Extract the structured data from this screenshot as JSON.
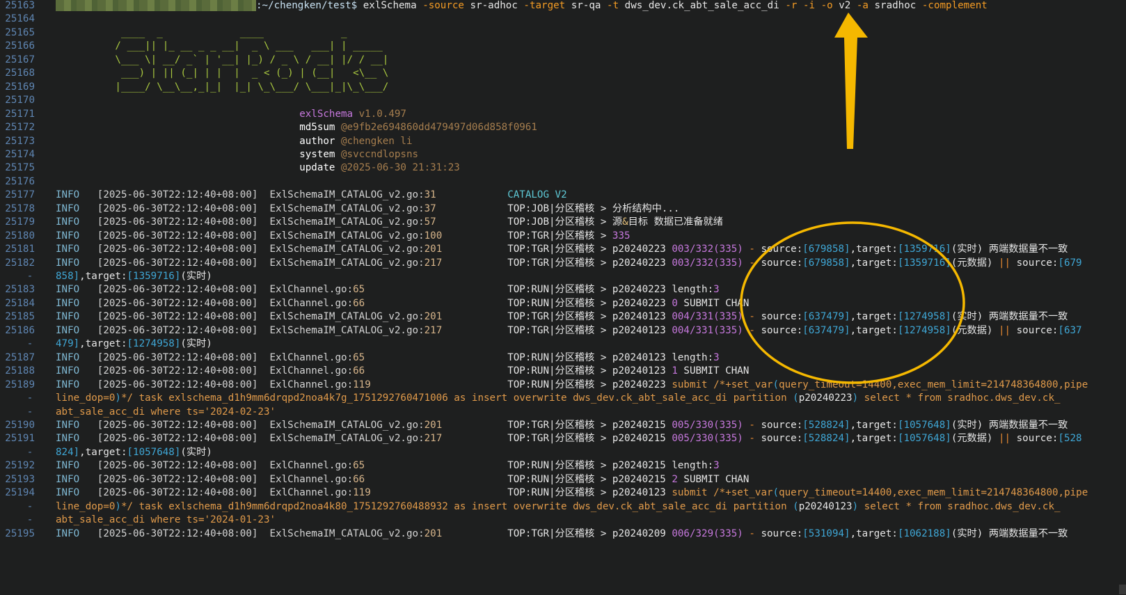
{
  "terminal": {
    "prompt": {
      "path": ":~/chengken/test$",
      "command": "exlSchema",
      "args": [
        {
          "flag": "-source",
          "value": "sr-adhoc"
        },
        {
          "flag": "-target",
          "value": "sr-qa"
        },
        {
          "flag": "-t",
          "value": "dws_dev.ck_abt_sale_acc_di"
        },
        {
          "flag": "-r",
          "value": ""
        },
        {
          "flag": "-i",
          "value": ""
        },
        {
          "flag": "-o",
          "value": "v2"
        },
        {
          "flag": "-a",
          "value": "sradhoc"
        },
        {
          "flag": "-complement",
          "value": ""
        }
      ]
    },
    "ascii_art": [
      " ____  _             ____             _",
      "/ ___|| |_ __ _ _ __|  _ \\ ___   ___| | _____",
      "\\___ \\| __/ _` | '__| |_) / _ \\ / __| |/ / __|",
      " ___) | || (_| | |  |  _ < (_) | (__|   <\\__ \\",
      "|____/ \\__\\__,_|_|  |_| \\_\\___/ \\___|_|\\_\\___/"
    ],
    "meta": {
      "name": "exlSchema",
      "version": "v1.0.497",
      "md5sum_label": "md5sum",
      "md5sum": "@e9fb2e694860dd479497d06d858f0961",
      "author_label": "author",
      "author": "@chengken li",
      "system_label": "system",
      "system": "@svccndlopsns",
      "update_label": "update",
      "update": "@2025-06-30 21:31:23"
    },
    "line_numbers": [
      "25163",
      "25164",
      "25165",
      "25166",
      "25167",
      "25168",
      "25169",
      "25170",
      "25171",
      "25172",
      "25173",
      "25174",
      "25175",
      "25176",
      "25177",
      "25178",
      "25179",
      "25180",
      "25181",
      "25182",
      "25183",
      "25184",
      "25185",
      "25186",
      "25187",
      "25188",
      "25189",
      "25190",
      "25191",
      "25192",
      "25193",
      "25194",
      "25195"
    ],
    "logs": [
      {
        "level": "INFO",
        "ts": "2025-06-30T22:12:40+08:00",
        "file": "ExlSchemaIM_CATALOG_v2.go",
        "line": "31",
        "msg": [
          {
            "t": "CATALOG V2",
            "c": "cat"
          }
        ]
      },
      {
        "level": "INFO",
        "ts": "2025-06-30T22:12:40+08:00",
        "file": "ExlSchemaIM_CATALOG_v2.go",
        "line": "37",
        "msg": [
          {
            "t": "TOP:JOB|分区稽核 > 分析结构中...",
            "c": "msg"
          }
        ]
      },
      {
        "level": "INFO",
        "ts": "2025-06-30T22:12:40+08:00",
        "file": "ExlSchemaIM_CATALOG_v2.go",
        "line": "57",
        "msg": [
          {
            "t": "TOP:JOB|分区稽核 > 源",
            "c": "msg"
          },
          {
            "t": "&",
            "c": "amp"
          },
          {
            "t": "目标 数据已准备就绪",
            "c": "msg"
          }
        ]
      },
      {
        "level": "INFO",
        "ts": "2025-06-30T22:12:40+08:00",
        "file": "ExlSchemaIM_CATALOG_v2.go",
        "line": "100",
        "msg": [
          {
            "t": "TOP:TGR|分区稽核 > ",
            "c": "msg"
          },
          {
            "t": "335",
            "c": "pur"
          }
        ]
      },
      {
        "level": "INFO",
        "ts": "2025-06-30T22:12:40+08:00",
        "file": "ExlSchemaIM_CATALOG_v2.go",
        "line": "201",
        "msg": [
          {
            "t": "TOP:TGR|分区稽核 > p20240223 ",
            "c": "msg"
          },
          {
            "t": "003/332(335)",
            "c": "pur"
          },
          {
            "t": " - ",
            "c": "orng"
          },
          {
            "t": "source:",
            "c": "msg"
          },
          {
            "t": "[679858]",
            "c": "brk"
          },
          {
            "t": ",target:",
            "c": "msg"
          },
          {
            "t": "[1359716]",
            "c": "brk"
          },
          {
            "t": "(实时)",
            "c": "msg"
          },
          {
            "t": " 两端数据量不一致",
            "c": "msg"
          }
        ]
      },
      {
        "level": "INFO",
        "ts": "2025-06-30T22:12:40+08:00",
        "file": "ExlSchemaIM_CATALOG_v2.go",
        "line": "217",
        "msg": [
          {
            "t": "TOP:TGR|分区稽核 > p20240223 ",
            "c": "msg"
          },
          {
            "t": "003/332(335)",
            "c": "pur"
          },
          {
            "t": " - ",
            "c": "orng"
          },
          {
            "t": "source:",
            "c": "msg"
          },
          {
            "t": "[679858]",
            "c": "brk"
          },
          {
            "t": ",target:",
            "c": "msg"
          },
          {
            "t": "[1359716]",
            "c": "brk"
          },
          {
            "t": "(元数据)",
            "c": "msg"
          },
          {
            "t": " || ",
            "c": "orng"
          },
          {
            "t": "source:",
            "c": "msg"
          },
          {
            "t": "[679",
            "c": "brk"
          }
        ],
        "cont": [
          {
            "t": "858]",
            "c": "brk"
          },
          {
            "t": ",target:",
            "c": "msg"
          },
          {
            "t": "[1359716]",
            "c": "brk"
          },
          {
            "t": "(实时)",
            "c": "msg"
          }
        ]
      },
      {
        "level": "INFO",
        "ts": "2025-06-30T22:12:40+08:00",
        "file": "ExlChannel.go",
        "line": "65",
        "msg": [
          {
            "t": "TOP:RUN|分区稽核 > p20240223 length:",
            "c": "msg"
          },
          {
            "t": "3",
            "c": "pur"
          }
        ]
      },
      {
        "level": "INFO",
        "ts": "2025-06-30T22:12:40+08:00",
        "file": "ExlChannel.go",
        "line": "66",
        "msg": [
          {
            "t": "TOP:RUN|分区稽核 > p20240223 ",
            "c": "msg"
          },
          {
            "t": "0",
            "c": "pur"
          },
          {
            "t": " SUBMIT CHAN",
            "c": "msg"
          }
        ]
      },
      {
        "level": "INFO",
        "ts": "2025-06-30T22:12:40+08:00",
        "file": "ExlSchemaIM_CATALOG_v2.go",
        "line": "201",
        "msg": [
          {
            "t": "TOP:TGR|分区稽核 > p20240123 ",
            "c": "msg"
          },
          {
            "t": "004/331(335)",
            "c": "pur"
          },
          {
            "t": " - ",
            "c": "orng"
          },
          {
            "t": "source:",
            "c": "msg"
          },
          {
            "t": "[637479]",
            "c": "brk"
          },
          {
            "t": ",target:",
            "c": "msg"
          },
          {
            "t": "[1274958]",
            "c": "brk"
          },
          {
            "t": "(实时)",
            "c": "msg"
          },
          {
            "t": " 两端数据量不一致",
            "c": "msg"
          }
        ]
      },
      {
        "level": "INFO",
        "ts": "2025-06-30T22:12:40+08:00",
        "file": "ExlSchemaIM_CATALOG_v2.go",
        "line": "217",
        "msg": [
          {
            "t": "TOP:TGR|分区稽核 > p20240123 ",
            "c": "msg"
          },
          {
            "t": "004/331(335)",
            "c": "pur"
          },
          {
            "t": " - ",
            "c": "orng"
          },
          {
            "t": "source:",
            "c": "msg"
          },
          {
            "t": "[637479]",
            "c": "brk"
          },
          {
            "t": ",target:",
            "c": "msg"
          },
          {
            "t": "[1274958]",
            "c": "brk"
          },
          {
            "t": "(元数据)",
            "c": "msg"
          },
          {
            "t": " || ",
            "c": "orng"
          },
          {
            "t": "source:",
            "c": "msg"
          },
          {
            "t": "[637",
            "c": "brk"
          }
        ],
        "cont": [
          {
            "t": "479]",
            "c": "brk"
          },
          {
            "t": ",target:",
            "c": "msg"
          },
          {
            "t": "[1274958]",
            "c": "brk"
          },
          {
            "t": "(实时)",
            "c": "msg"
          }
        ]
      },
      {
        "level": "INFO",
        "ts": "2025-06-30T22:12:40+08:00",
        "file": "ExlChannel.go",
        "line": "65",
        "msg": [
          {
            "t": "TOP:RUN|分区稽核 > p20240123 length:",
            "c": "msg"
          },
          {
            "t": "3",
            "c": "pur"
          }
        ]
      },
      {
        "level": "INFO",
        "ts": "2025-06-30T22:12:40+08:00",
        "file": "ExlChannel.go",
        "line": "66",
        "msg": [
          {
            "t": "TOP:RUN|分区稽核 > p20240123 ",
            "c": "msg"
          },
          {
            "t": "1",
            "c": "pur"
          },
          {
            "t": " SUBMIT CHAN",
            "c": "msg"
          }
        ]
      },
      {
        "level": "INFO",
        "ts": "2025-06-30T22:12:40+08:00",
        "file": "ExlChannel.go",
        "line": "119",
        "msg": [
          {
            "t": "TOP:RUN|分区稽核 > p20240223 ",
            "c": "msg"
          },
          {
            "t": "submit /*+set_var",
            "c": "sqlstr"
          },
          {
            "t": "(",
            "c": "cyanp"
          },
          {
            "t": "query_timeout=14400,exec_mem_limit=214748364800,pipe",
            "c": "sqlstr"
          }
        ],
        "cont": [
          {
            "t": "line_dop=0",
            "c": "sqlstr"
          },
          {
            "t": ")",
            "c": "cyanp"
          },
          {
            "t": "*/ task exlschema_d1h9mm6drqpd2noa4k7g_1751292760471006 as insert overwrite dws_dev.ck_abt_sale_acc_di partition ",
            "c": "sqlstr"
          },
          {
            "t": "(",
            "c": "cyanp"
          },
          {
            "t": "p20240223",
            "c": "msg"
          },
          {
            "t": ")",
            "c": "cyanp"
          },
          {
            "t": " select * from sradhoc.dws_dev.ck_",
            "c": "sqlstr"
          }
        ],
        "cont2": [
          {
            "t": "abt_sale_acc_di where ts='2024-02-23'",
            "c": "sqlstr"
          }
        ]
      },
      {
        "level": "INFO",
        "ts": "2025-06-30T22:12:40+08:00",
        "file": "ExlSchemaIM_CATALOG_v2.go",
        "line": "201",
        "msg": [
          {
            "t": "TOP:TGR|分区稽核 > p20240215 ",
            "c": "msg"
          },
          {
            "t": "005/330(335)",
            "c": "pur"
          },
          {
            "t": " - ",
            "c": "orng"
          },
          {
            "t": "source:",
            "c": "msg"
          },
          {
            "t": "[528824]",
            "c": "brk"
          },
          {
            "t": ",target:",
            "c": "msg"
          },
          {
            "t": "[1057648]",
            "c": "brk"
          },
          {
            "t": "(实时)",
            "c": "msg"
          },
          {
            "t": " 两端数据量不一致",
            "c": "msg"
          }
        ]
      },
      {
        "level": "INFO",
        "ts": "2025-06-30T22:12:40+08:00",
        "file": "ExlSchemaIM_CATALOG_v2.go",
        "line": "217",
        "msg": [
          {
            "t": "TOP:TGR|分区稽核 > p20240215 ",
            "c": "msg"
          },
          {
            "t": "005/330(335)",
            "c": "pur"
          },
          {
            "t": " - ",
            "c": "orng"
          },
          {
            "t": "source:",
            "c": "msg"
          },
          {
            "t": "[528824]",
            "c": "brk"
          },
          {
            "t": ",target:",
            "c": "msg"
          },
          {
            "t": "[1057648]",
            "c": "brk"
          },
          {
            "t": "(元数据)",
            "c": "msg"
          },
          {
            "t": " || ",
            "c": "orng"
          },
          {
            "t": "source:",
            "c": "msg"
          },
          {
            "t": "[528",
            "c": "brk"
          }
        ],
        "cont": [
          {
            "t": "824]",
            "c": "brk"
          },
          {
            "t": ",target:",
            "c": "msg"
          },
          {
            "t": "[1057648]",
            "c": "brk"
          },
          {
            "t": "(实时)",
            "c": "msg"
          }
        ]
      },
      {
        "level": "INFO",
        "ts": "2025-06-30T22:12:40+08:00",
        "file": "ExlChannel.go",
        "line": "65",
        "msg": [
          {
            "t": "TOP:RUN|分区稽核 > p20240215 length:",
            "c": "msg"
          },
          {
            "t": "3",
            "c": "pur"
          }
        ]
      },
      {
        "level": "INFO",
        "ts": "2025-06-30T22:12:40+08:00",
        "file": "ExlChannel.go",
        "line": "66",
        "msg": [
          {
            "t": "TOP:RUN|分区稽核 > p20240215 ",
            "c": "msg"
          },
          {
            "t": "2",
            "c": "pur"
          },
          {
            "t": " SUBMIT CHAN",
            "c": "msg"
          }
        ]
      },
      {
        "level": "INFO",
        "ts": "2025-06-30T22:12:40+08:00",
        "file": "ExlChannel.go",
        "line": "119",
        "msg": [
          {
            "t": "TOP:RUN|分区稽核 > p20240123 ",
            "c": "msg"
          },
          {
            "t": "submit /*+set_var",
            "c": "sqlstr"
          },
          {
            "t": "(",
            "c": "cyanp"
          },
          {
            "t": "query_timeout=14400,exec_mem_limit=214748364800,pipe",
            "c": "sqlstr"
          }
        ],
        "cont": [
          {
            "t": "line_dop=0",
            "c": "sqlstr"
          },
          {
            "t": ")",
            "c": "cyanp"
          },
          {
            "t": "*/ task exlschema_d1h9mm6drqpd2noa4k80_1751292760488932 as insert overwrite dws_dev.ck_abt_sale_acc_di partition ",
            "c": "sqlstr"
          },
          {
            "t": "(",
            "c": "cyanp"
          },
          {
            "t": "p20240123",
            "c": "msg"
          },
          {
            "t": ")",
            "c": "cyanp"
          },
          {
            "t": " select * from sradhoc.dws_dev.ck_",
            "c": "sqlstr"
          }
        ],
        "cont2": [
          {
            "t": "abt_sale_acc_di where ts='2024-01-23'",
            "c": "sqlstr"
          }
        ]
      },
      {
        "level": "INFO",
        "ts": "2025-06-30T22:12:40+08:00",
        "file": "ExlSchemaIM_CATALOG_v2.go",
        "line": "201",
        "msg": [
          {
            "t": "TOP:TGR|分区稽核 > p20240209 ",
            "c": "msg"
          },
          {
            "t": "006/329(335)",
            "c": "pur"
          },
          {
            "t": " - ",
            "c": "orng"
          },
          {
            "t": "source:",
            "c": "msg"
          },
          {
            "t": "[531094]",
            "c": "brk"
          },
          {
            "t": ",target:",
            "c": "msg"
          },
          {
            "t": "[1062188]",
            "c": "brk"
          },
          {
            "t": "(实时)",
            "c": "msg"
          },
          {
            "t": " 两端数据量不一致",
            "c": "msg"
          }
        ]
      }
    ],
    "continuation_marker": "-",
    "colors": {
      "background": "#1e1f1f",
      "line_number": "#5f86b3",
      "flag": "#f39b24",
      "info": "#7fb8d3",
      "number": "#c678dd",
      "bracket": "#3fa7d6",
      "annotation": "#f5b800"
    },
    "annotations": {
      "arrow_icon": "arrow-up-annotation",
      "ellipse_icon": "highlight-ellipse-annotation"
    }
  }
}
